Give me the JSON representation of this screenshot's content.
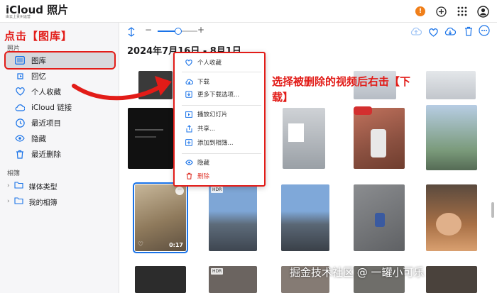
{
  "app": {
    "title": "iCloud 照片",
    "subtitle": "由云上贵州运营",
    "notification_badge": "!"
  },
  "annotation_top": "点击【图库】",
  "annotation_note": "选择被删除的视频后右击【下载】",
  "sidebar": {
    "section_photos": "照片",
    "items": [
      {
        "label": "图库",
        "icon": "library-icon"
      },
      {
        "label": "回忆",
        "icon": "memories-icon"
      },
      {
        "label": "个人收藏",
        "icon": "heart-icon"
      },
      {
        "label": "iCloud 链接",
        "icon": "cloud-link-icon"
      },
      {
        "label": "最近项目",
        "icon": "clock-icon"
      },
      {
        "label": "隐藏",
        "icon": "eye-icon"
      },
      {
        "label": "最近删除",
        "icon": "trash-icon"
      }
    ],
    "section_albums": "相簿",
    "albums": [
      {
        "label": "媒体类型"
      },
      {
        "label": "我的相簿"
      }
    ]
  },
  "toolbar": {
    "zoom_level": 0.5
  },
  "main": {
    "date_heading": "2024年7月16日 - 8月1日"
  },
  "thumbnails": {
    "hdr_label": "HDR",
    "video_duration": "0:17",
    "more_label": "···"
  },
  "context_menu": {
    "items": [
      {
        "label": "个人收藏",
        "icon": "heart-icon"
      },
      {
        "label": "下载",
        "icon": "download-icon"
      },
      {
        "label": "更多下载选项...",
        "icon": "download-options-icon"
      },
      {
        "label": "播放幻灯片",
        "icon": "slideshow-icon"
      },
      {
        "label": "共享...",
        "icon": "share-icon"
      },
      {
        "label": "添加到相簿...",
        "icon": "add-album-icon"
      },
      {
        "label": "隐藏",
        "icon": "eye-icon"
      },
      {
        "label": "删除",
        "icon": "trash-icon"
      }
    ]
  },
  "watermark": "掘金技术社区 @ 一罐小可乐",
  "colors": {
    "accent": "#1a73e8",
    "annotation": "#e21c18",
    "danger": "#e0392f"
  }
}
